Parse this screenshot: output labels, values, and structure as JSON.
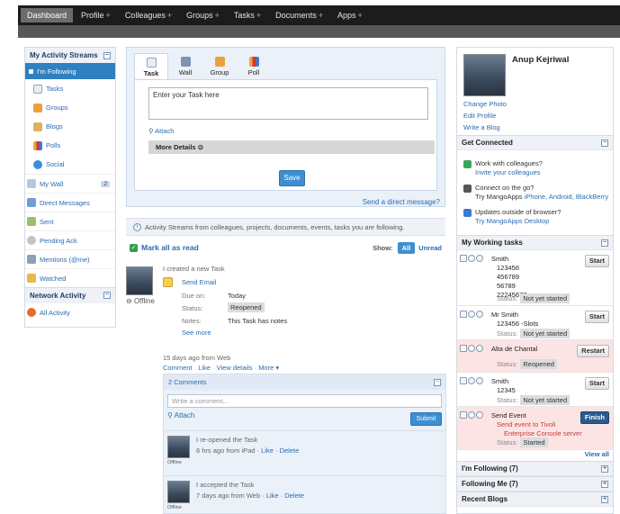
{
  "nav": {
    "items": [
      {
        "label": "Dashboard",
        "plus": ""
      },
      {
        "label": "Profile",
        "plus": "+"
      },
      {
        "label": "Colleagues",
        "plus": "+"
      },
      {
        "label": "Groups",
        "plus": "+"
      },
      {
        "label": "Tasks",
        "plus": "+"
      },
      {
        "label": "Documents",
        "plus": "+"
      },
      {
        "label": "Apps",
        "plus": "+"
      }
    ],
    "active": "Dashboard"
  },
  "left": {
    "activity_title": "My Activity Streams",
    "following": "I'm Following",
    "sub_items": [
      "Tasks",
      "Groups",
      "Blogs",
      "Polls",
      "Social"
    ],
    "items": [
      {
        "label": "My Wall",
        "badge": "2"
      },
      {
        "label": "Direct Messages"
      },
      {
        "label": "Sent"
      },
      {
        "label": "Pending Ack"
      },
      {
        "label": "Mentions (@me)"
      },
      {
        "label": "Watched"
      }
    ],
    "network_title": "Network Activity",
    "network_item": "All Activity"
  },
  "composer": {
    "tabs": [
      "Task",
      "Wall",
      "Group",
      "Poll"
    ],
    "active_tab": "Task",
    "input_placeholder": "Enter your Task here",
    "attach": "Attach",
    "more_details": "More Details",
    "save": "Save",
    "direct_message": "Send a direct message?"
  },
  "stream": {
    "info": "Activity Streams from colleagues, projects, documents, events, tasks you are following.",
    "mark_all": "Mark all as read",
    "show_label": "Show:",
    "show_all": "All",
    "show_unread": "Unread"
  },
  "post": {
    "offline": "Offline",
    "head_pre": "I",
    "head_text": "created a new Task",
    "send_email": "Send Email",
    "due_label": "Due on:",
    "due_val": "Today",
    "status_label": "Status:",
    "status_val": "Reopened",
    "notes_label": "Notes:",
    "notes_val": "This Task has notes",
    "see_more": "See more",
    "ago": "15 days ago from Web",
    "actions": [
      "Comment",
      "Like",
      "View details",
      "More"
    ]
  },
  "comments": {
    "count": "2 Comments",
    "placeholder": "Write a comment...",
    "attach": "Attach",
    "submit": "Submit",
    "items": [
      {
        "pre": "I",
        "text": "re-opened the Task",
        "ago": "6 hrs ago from iPad",
        "offline": "Offline"
      },
      {
        "pre": "I",
        "text": "accepted the Task",
        "ago": "7 days ago from Web",
        "offline": "Offline"
      }
    ],
    "like": "Like",
    "delete": "Delete"
  },
  "profile": {
    "name": "Anup Kejriwal",
    "links": [
      "Change Photo",
      "Edit Profile",
      "Write a Blog"
    ]
  },
  "connected": {
    "title": "Get Connected",
    "items": [
      {
        "l1": "Work with colleagues?",
        "l2": "Invite your colleagues"
      },
      {
        "l1": "Connect on the go?",
        "l2a": "Try MangoApps ",
        "l2b": "iPhone, Android, BlackBerry"
      },
      {
        "l1": "Updates outside of browser?",
        "l2": "Try MangoApps Desktop"
      }
    ]
  },
  "working": {
    "title": "My Working tasks",
    "status_label": "Status:",
    "tasks": [
      {
        "name": "Smith",
        "lines": [
          "123456",
          "456789",
          "56789",
          "22245677"
        ],
        "status": "Not yet started",
        "action": "Start",
        "style": ""
      },
      {
        "name": "Mr Smith",
        "lines": [
          "123456 -Slots"
        ],
        "status": "Not yet started",
        "action": "Start",
        "style": ""
      },
      {
        "name": "Alta de Chantal",
        "lines": [],
        "status": "Reopened",
        "action": "Restart",
        "style": "pink"
      },
      {
        "name": "Smith",
        "lines": [
          "12345"
        ],
        "status": "Not yet started",
        "action": "Start",
        "style": ""
      },
      {
        "name": "Send Event",
        "lines": [
          "Send event to Tivoli",
          "Enterprise Console server"
        ],
        "status": "Started",
        "action": "Finish",
        "style": "pink"
      }
    ],
    "view_all": "View all"
  },
  "bottom_sections": [
    "I'm Following (7)",
    "Following Me (7)",
    "Recent Blogs"
  ],
  "colors": {
    "nav_bg": "#1c1c1c",
    "accent": "#3d8fd1",
    "link": "#2a6bb5",
    "pink": "#fde4e4"
  }
}
